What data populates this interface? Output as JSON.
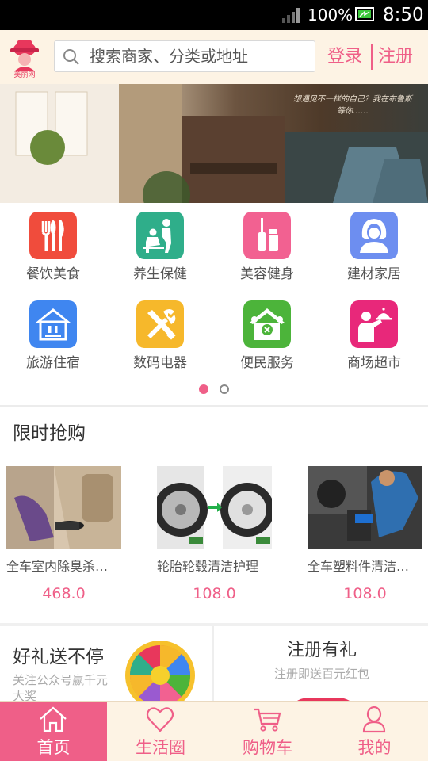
{
  "status_bar": {
    "battery": "100%",
    "time": "8:50"
  },
  "header": {
    "logo_text": "美丽网",
    "search_placeholder": "搜索商家、分类或地址",
    "login": "登录",
    "register": "注册"
  },
  "banner": {
    "text": "想遇见不一样的自己？我在布鲁斯等你……"
  },
  "categories": [
    {
      "label": "餐饮美食",
      "icon": "utensils-icon",
      "color": "#f04c3c"
    },
    {
      "label": "养生保健",
      "icon": "massage-icon",
      "color": "#2fae8a"
    },
    {
      "label": "美容健身",
      "icon": "cosmetics-icon",
      "color": "#f26191"
    },
    {
      "label": "建材家居",
      "icon": "person-icon",
      "color": "#6d8ef0"
    },
    {
      "label": "旅游住宿",
      "icon": "hotel-icon",
      "color": "#3f86f0"
    },
    {
      "label": "数码电器",
      "icon": "tools-icon",
      "color": "#f6b82b"
    },
    {
      "label": "便民服务",
      "icon": "house-icon",
      "color": "#4cb43a"
    },
    {
      "label": "商场超市",
      "icon": "waiter-icon",
      "color": "#e8287a"
    }
  ],
  "pager": {
    "count": 2,
    "active_index": 0
  },
  "flash_sale": {
    "title": "限时抢购",
    "products": [
      {
        "name": "全车室内除臭杀…",
        "price": "468.0"
      },
      {
        "name": "轮胎轮毂清洁护理",
        "price": "108.0"
      },
      {
        "name": "全车塑料件清洁…",
        "price": "108.0"
      }
    ]
  },
  "promo": {
    "left_title": "好礼送不停",
    "left_sub": "关注公众号赢千元大奖",
    "right_title": "注册有礼",
    "right_sub": "注册即送百元红包"
  },
  "nav": [
    {
      "label": "首页",
      "icon": "home-icon",
      "active": true
    },
    {
      "label": "生活圈",
      "icon": "heart-icon",
      "active": false
    },
    {
      "label": "购物车",
      "icon": "cart-icon",
      "active": false
    },
    {
      "label": "我的",
      "icon": "user-icon",
      "active": false
    }
  ],
  "colors": {
    "accent": "#ef5f88",
    "header_bg": "#fdf3e4",
    "status_bg": "#000000"
  }
}
